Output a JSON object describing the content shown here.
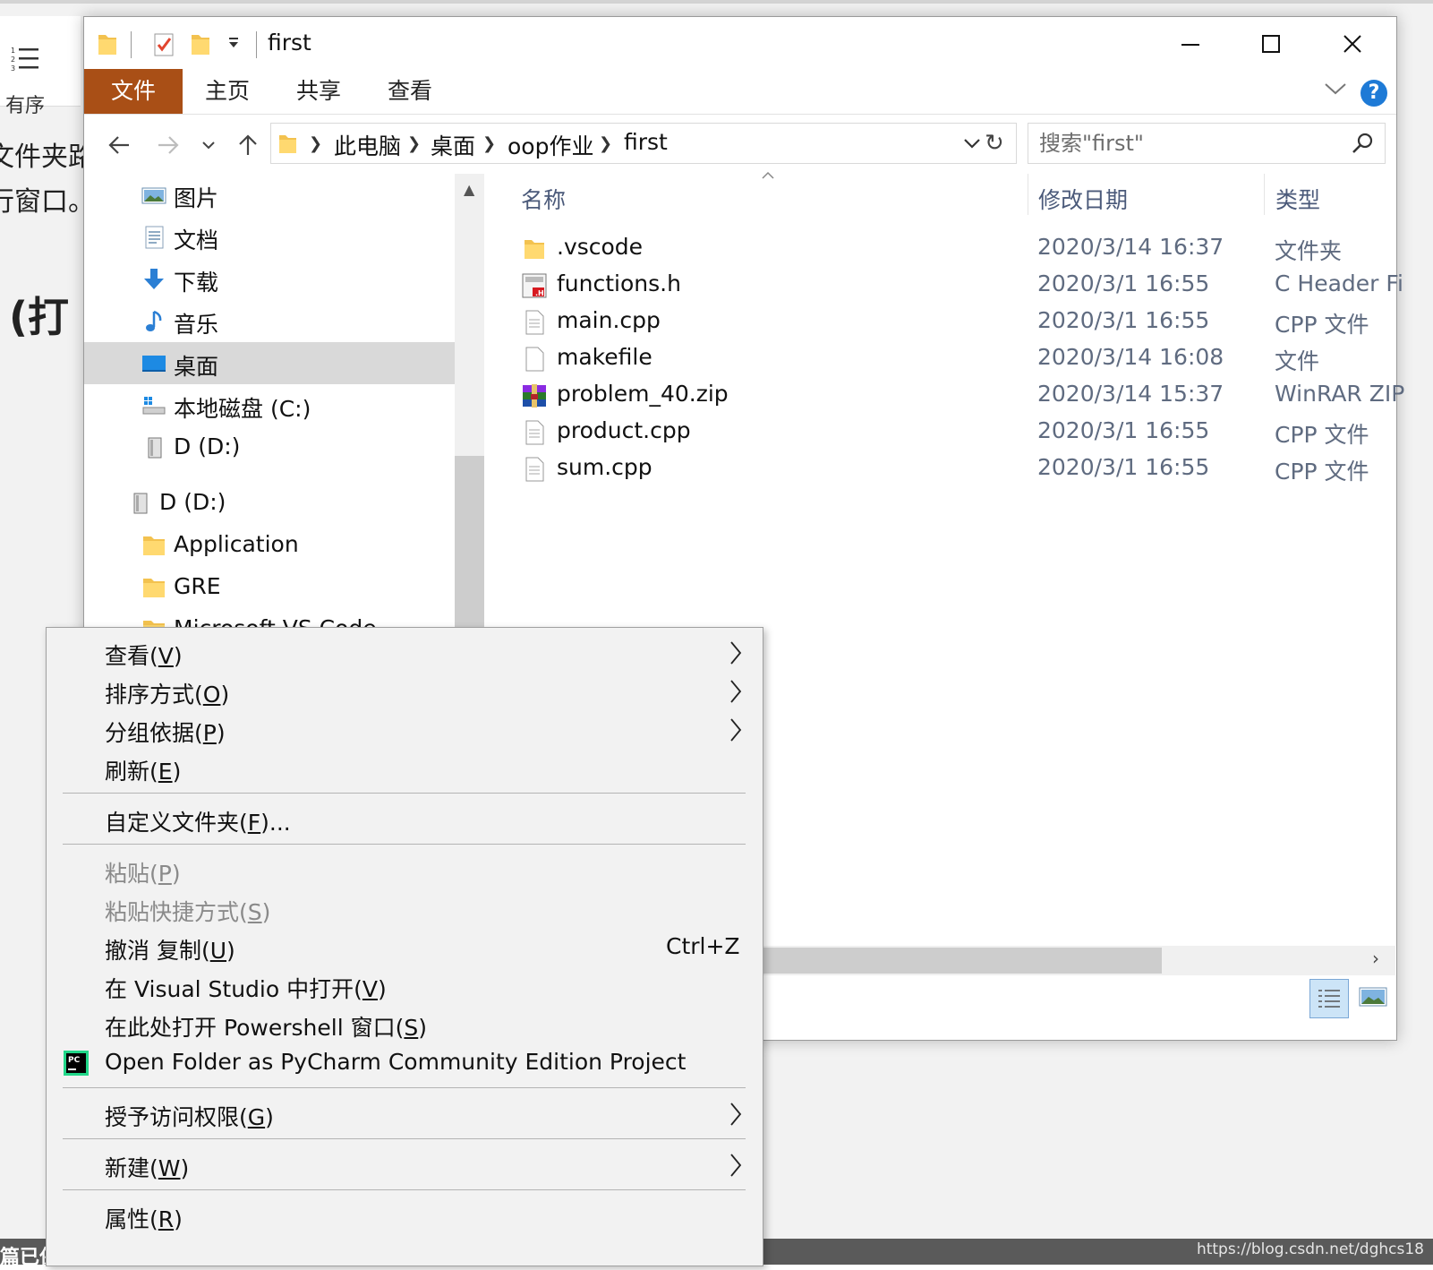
{
  "background": {
    "toolbar_label": "有序",
    "line1": "文件夹路",
    "line2": "行窗口。",
    "heading": "(打",
    "status_left": "篇已保",
    "watermark": "https://blog.csdn.net/dghcs18"
  },
  "window": {
    "title": "first",
    "tabs": {
      "file": "文件",
      "home": "主页",
      "share": "共享",
      "view": "查看"
    },
    "help": "?",
    "breadcrumbs": [
      "此电脑",
      "桌面",
      "oop作业",
      "first"
    ],
    "search_placeholder": "搜索\"first\""
  },
  "nav": {
    "items": [
      {
        "label": "图片",
        "icon": "pictures-icon"
      },
      {
        "label": "文档",
        "icon": "documents-icon"
      },
      {
        "label": "下载",
        "icon": "download-icon"
      },
      {
        "label": "音乐",
        "icon": "music-icon"
      },
      {
        "label": "桌面",
        "icon": "desktop-icon",
        "selected": true
      },
      {
        "label": "本地磁盘 (C:)",
        "icon": "drive-c-icon"
      },
      {
        "label": "D (D:)",
        "icon": "drive-d-icon"
      },
      {
        "label": "D (D:)",
        "icon": "drive-d-icon"
      },
      {
        "label": "Application",
        "icon": "folder-icon"
      },
      {
        "label": "GRE",
        "icon": "folder-icon"
      },
      {
        "label": "Microsoft VS Code",
        "icon": "folder-icon"
      }
    ]
  },
  "files": {
    "columns": {
      "name": "名称",
      "modified": "修改日期",
      "type": "类型"
    },
    "rows": [
      {
        "name": ".vscode",
        "date": "2020/3/14 16:37",
        "type": "文件夹",
        "icon": "folder-icon"
      },
      {
        "name": "functions.h",
        "date": "2020/3/1 16:55",
        "type": "C Header Fi",
        "icon": "header-file-icon"
      },
      {
        "name": "main.cpp",
        "date": "2020/3/1 16:55",
        "type": "CPP 文件",
        "icon": "text-file-icon"
      },
      {
        "name": "makefile",
        "date": "2020/3/14 16:08",
        "type": "文件",
        "icon": "blank-file-icon"
      },
      {
        "name": "problem_40.zip",
        "date": "2020/3/14 15:37",
        "type": "WinRAR ZIP",
        "icon": "winrar-icon"
      },
      {
        "name": "product.cpp",
        "date": "2020/3/1 16:55",
        "type": "CPP 文件",
        "icon": "text-file-icon"
      },
      {
        "name": "sum.cpp",
        "date": "2020/3/1 16:55",
        "type": "CPP 文件",
        "icon": "text-file-icon"
      }
    ]
  },
  "context_menu": {
    "view": {
      "text": "查看(",
      "key": "V",
      "end": ")"
    },
    "sort": {
      "text": "排序方式(",
      "key": "O",
      "end": ")"
    },
    "group": {
      "text": "分组依据(",
      "key": "P",
      "end": ")"
    },
    "refresh": {
      "text": "刷新(",
      "key": "E",
      "end": ")"
    },
    "customize": {
      "text": "自定义文件夹(",
      "key": "F",
      "end": ")..."
    },
    "paste": {
      "text": "粘贴(",
      "key": "P",
      "end": ")"
    },
    "paste_shortcut": {
      "text": "粘贴快捷方式(",
      "key": "S",
      "end": ")"
    },
    "undo": {
      "text": "撤消 复制(",
      "key": "U",
      "end": ")",
      "shortcut": "Ctrl+Z"
    },
    "open_vs": {
      "text": "在 Visual Studio 中打开(",
      "key": "V",
      "end": ")"
    },
    "powershell": {
      "text": "在此处打开 Powershell 窗口(",
      "key": "S",
      "end": ")"
    },
    "pycharm": {
      "text": "Open Folder as PyCharm Community Edition Project"
    },
    "access": {
      "text": "授予访问权限(",
      "key": "G",
      "end": ")"
    },
    "new": {
      "text": "新建(",
      "key": "W",
      "end": ")"
    },
    "properties": {
      "text": "属性(",
      "key": "R",
      "end": ")"
    }
  }
}
